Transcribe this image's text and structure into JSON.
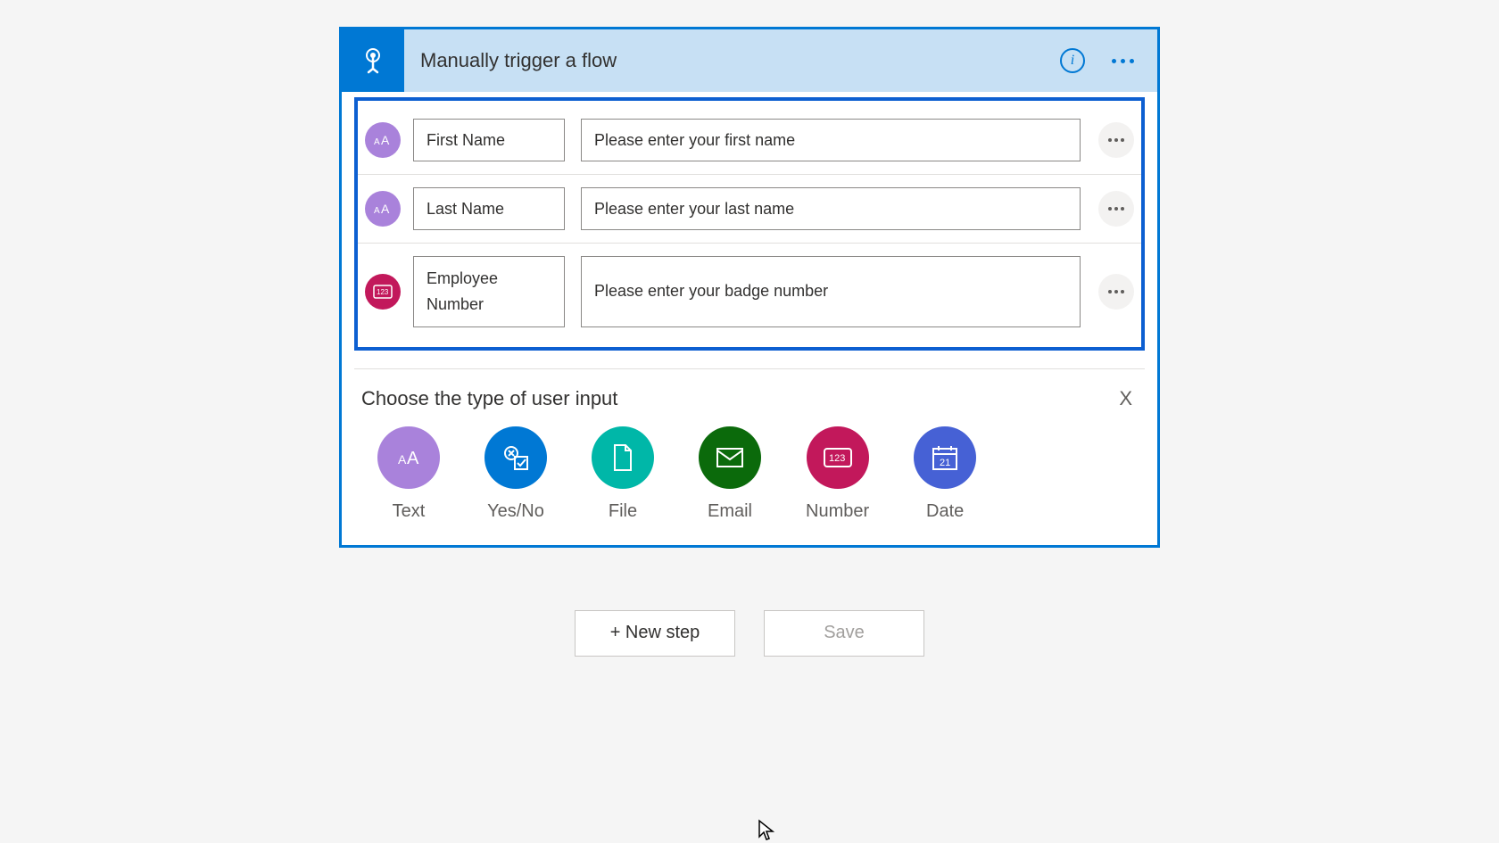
{
  "header": {
    "title": "Manually trigger a flow"
  },
  "inputs": [
    {
      "icon": "text",
      "name": "First Name",
      "placeholder": "Please enter your first name"
    },
    {
      "icon": "text",
      "name": "Last Name",
      "placeholder": "Please enter your last name"
    },
    {
      "icon": "number",
      "name": "Employee Number",
      "placeholder": "Please enter your badge number"
    }
  ],
  "picker": {
    "title": "Choose the type of user input",
    "close": "X",
    "options": [
      {
        "label": "Text",
        "kind": "text"
      },
      {
        "label": "Yes/No",
        "kind": "yesno"
      },
      {
        "label": "File",
        "kind": "file"
      },
      {
        "label": "Email",
        "kind": "email"
      },
      {
        "label": "Number",
        "kind": "number"
      },
      {
        "label": "Date",
        "kind": "date"
      }
    ]
  },
  "footer": {
    "newStep": "+ New step",
    "save": "Save"
  }
}
